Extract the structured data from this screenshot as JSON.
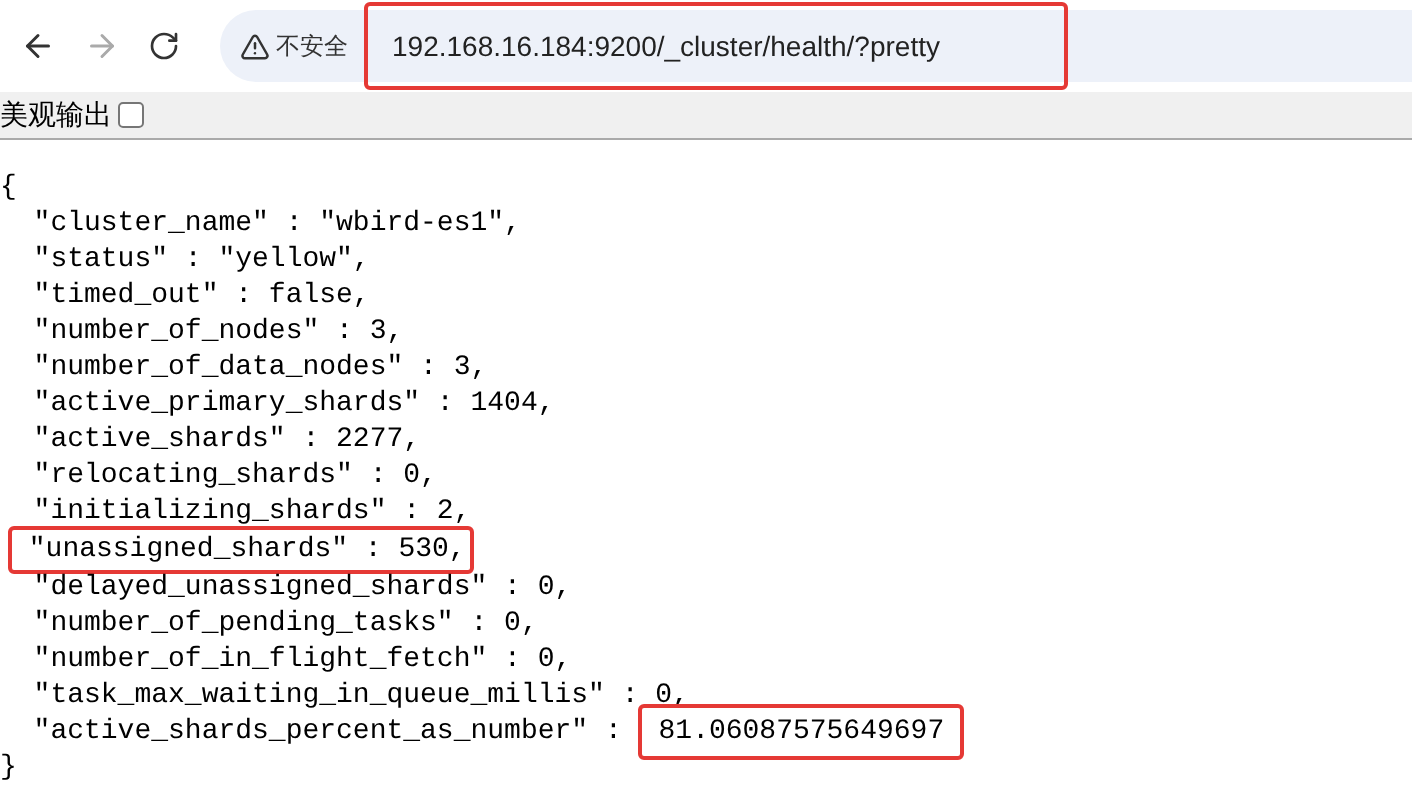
{
  "toolbar": {
    "insecure_label": "不安全",
    "url": "192.168.16.184:9200/_cluster/health/?pretty",
    "url_highlighted": true
  },
  "pretty_print": {
    "label": "美观输出",
    "checked": false
  },
  "json_lines": [
    {
      "text": "{",
      "highlighted": false
    },
    {
      "text": "  \"cluster_name\" : \"wbird-es1\",",
      "highlighted": false
    },
    {
      "text": "  \"status\" : \"yellow\",",
      "highlighted": false
    },
    {
      "text": "  \"timed_out\" : false,",
      "highlighted": false
    },
    {
      "text": "  \"number_of_nodes\" : 3,",
      "highlighted": false
    },
    {
      "text": "  \"number_of_data_nodes\" : 3,",
      "highlighted": false
    },
    {
      "text": "  \"active_primary_shards\" : 1404,",
      "highlighted": false
    },
    {
      "text": "  \"active_shards\" : 2277,",
      "highlighted": false
    },
    {
      "text": "  \"relocating_shards\" : 0,",
      "highlighted": false
    },
    {
      "text": "  \"initializing_shards\" : 2,",
      "highlighted": false
    },
    {
      "text": "  \"unassigned_shards\" : 530,",
      "highlighted": true
    },
    {
      "text": "  \"delayed_unassigned_shards\" : 0,",
      "highlighted": false
    },
    {
      "text": "  \"number_of_pending_tasks\" : 0,",
      "highlighted": false
    },
    {
      "text": "  \"number_of_in_flight_fetch\" : 0,",
      "highlighted": false
    },
    {
      "text": "  \"task_max_waiting_in_queue_millis\" : 0,",
      "highlighted": false
    },
    {
      "text": "  \"active_shards_percent_as_number\" : ",
      "value": "81.06087575649697",
      "highlighted": true
    },
    {
      "text": "}",
      "highlighted": false
    }
  ]
}
